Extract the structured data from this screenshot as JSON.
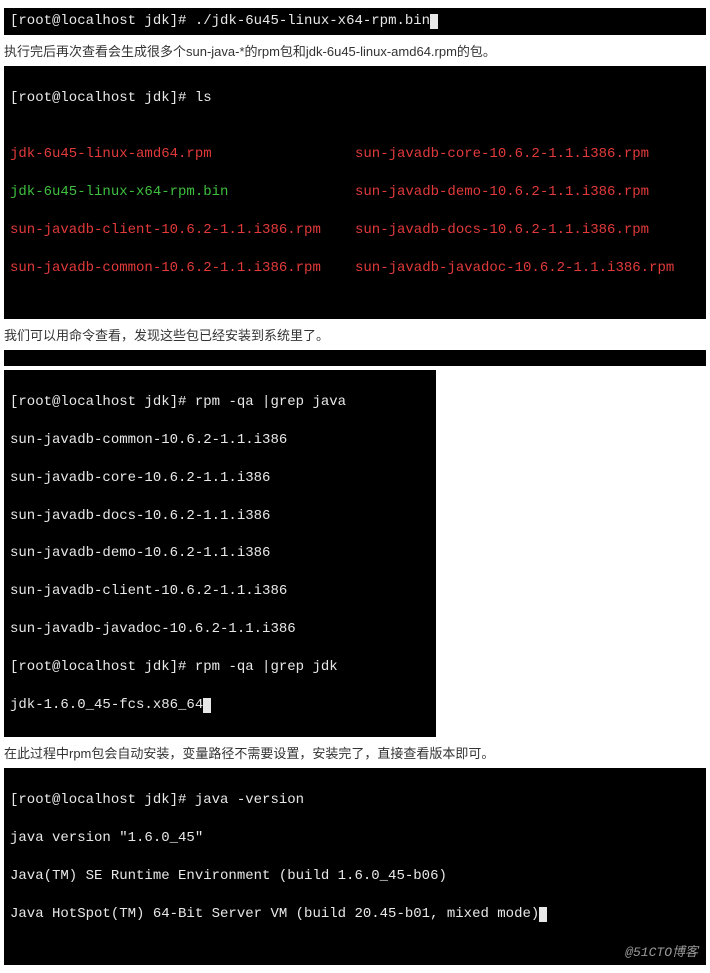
{
  "block1": {
    "prompt": "[root@localhost jdk]# ",
    "cmd": "./jdk-6u45-linux-x64-rpm.bin"
  },
  "note1_a": "执行完后再次查看会生成很多个sun-java-*的rpm包和jdk-6u45-linux-amd64.rpm的包。",
  "block2": {
    "prompt": "[root@localhost jdk]# ",
    "cmd": "ls",
    "col1": {
      "l1": "jdk-6u45-linux-amd64.rpm",
      "l2": "jdk-6u45-linux-x64-rpm.bin",
      "l3": "sun-javadb-client-10.6.2-1.1.i386.rpm",
      "l4": "sun-javadb-common-10.6.2-1.1.i386.rpm"
    },
    "col2": {
      "l1": "sun-javadb-core-10.6.2-1.1.i386.rpm",
      "l2": "sun-javadb-demo-10.6.2-1.1.i386.rpm",
      "l3": "sun-javadb-docs-10.6.2-1.1.i386.rpm",
      "l4": "sun-javadb-javadoc-10.6.2-1.1.i386.rpm"
    }
  },
  "note2": "我们可以用命令查看，发现这些包已经安装到系统里了。",
  "block3": {
    "prompt1": "[root@localhost jdk]# ",
    "cmd1": "rpm -qa |grep java",
    "l1": "sun-javadb-common-10.6.2-1.1.i386",
    "l2": "sun-javadb-core-10.6.2-1.1.i386",
    "l3": "sun-javadb-docs-10.6.2-1.1.i386",
    "l4": "sun-javadb-demo-10.6.2-1.1.i386",
    "l5": "sun-javadb-client-10.6.2-1.1.i386",
    "l6": "sun-javadb-javadoc-10.6.2-1.1.i386",
    "prompt2": "[root@localhost jdk]# ",
    "cmd2": "rpm -qa |grep jdk",
    "l7": "jdk-1.6.0_45-fcs.x86_64"
  },
  "note3": "在此过程中rpm包会自动安装，变量路径不需要设置，安装完了，直接查看版本即可。",
  "block4": {
    "prompt": "[root@localhost jdk]# ",
    "cmd": "java -version",
    "l1": "java version \"1.6.0_45\"",
    "l2": "Java(TM) SE Runtime Environment (build 1.6.0_45-b06)",
    "l3": "Java HotSpot(TM) 64-Bit Server VM (build 20.45-b01, mixed mode)"
  },
  "watermark": "@51CTO博客"
}
